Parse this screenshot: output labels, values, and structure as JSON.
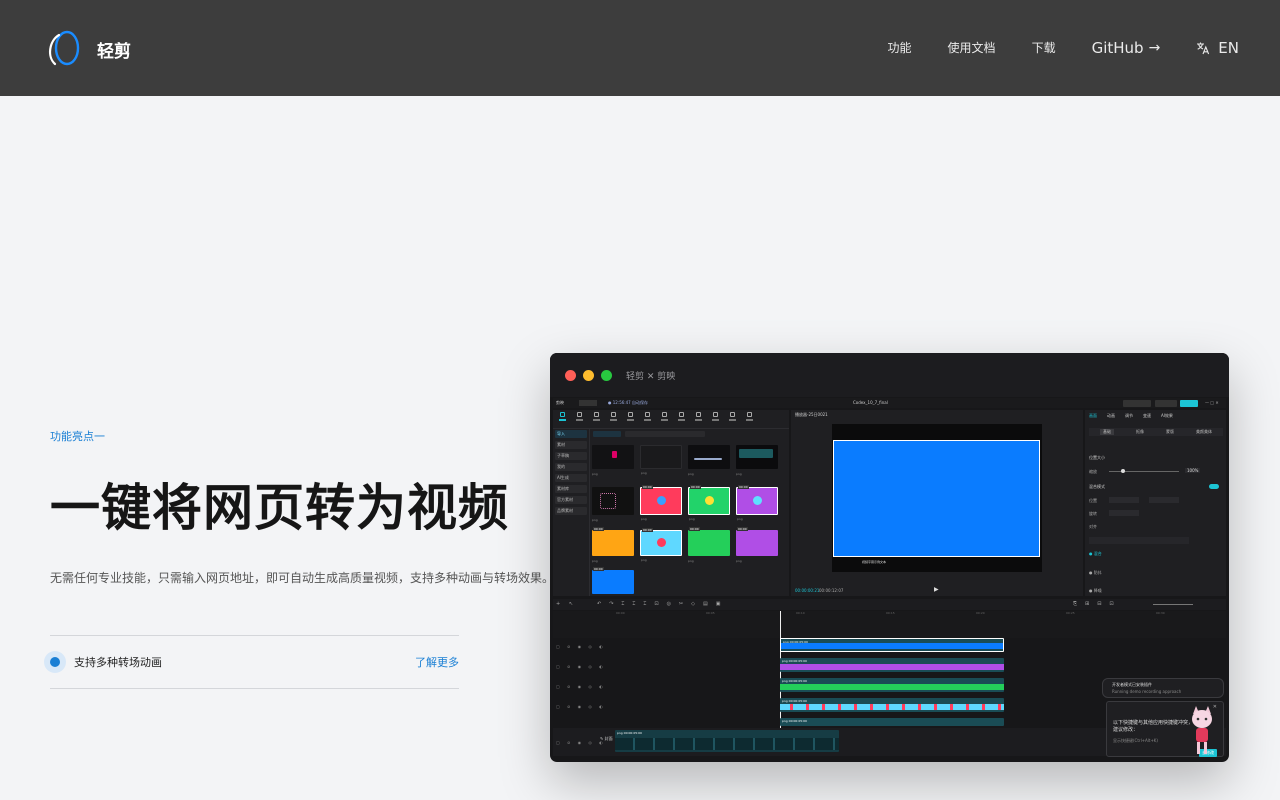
{
  "header": {
    "brand": "轻剪",
    "nav": [
      "功能",
      "使用文档",
      "下载"
    ],
    "github": "GitHub",
    "lang": "EN"
  },
  "hero": {
    "eyebrow": "功能亮点一",
    "title": "一键将网页转为视频",
    "description": "无需任何专业技能，只需输入网页地址，即可自动生成高质量视频，支持多种动画与转场效果。",
    "feature_label": "支持多种转场动画",
    "feature_link": "了解更多"
  },
  "preview": {
    "window_title": "轻剪 ✕ 剪映",
    "colors": {
      "red": "#ff5f57",
      "yellow": "#febc2e",
      "green": "#28c840",
      "accent": "#0a7cff",
      "teal": "#1cc4d4"
    },
    "editor": {
      "app_name": "剪映",
      "draft_name": "Codex_10_7_final",
      "player_label": "播放器-25日0021",
      "tabs_right": [
        "画面",
        "动画",
        "调节",
        "变速",
        "AI效果"
      ],
      "sub_tabs_right": [
        "基础",
        "抠像",
        "蒙版",
        "美颜美体"
      ],
      "prop_labels": [
        "位置大小",
        "缩放",
        "混合模式",
        "位置",
        "旋转",
        "对齐"
      ],
      "scale_value": "100%",
      "timecode": "00:00:00:21",
      "duration": "00:00:12:07",
      "popup_title": "开发者模式已安装插件",
      "popup_subtitle": "Running demo recording approach",
      "popup_body": "以下快捷键与其他应用快捷键冲突，建议修改：",
      "popup_hint": "显示快捷键(Ctrl+Alt+K)",
      "popup_button": "去修改"
    }
  }
}
